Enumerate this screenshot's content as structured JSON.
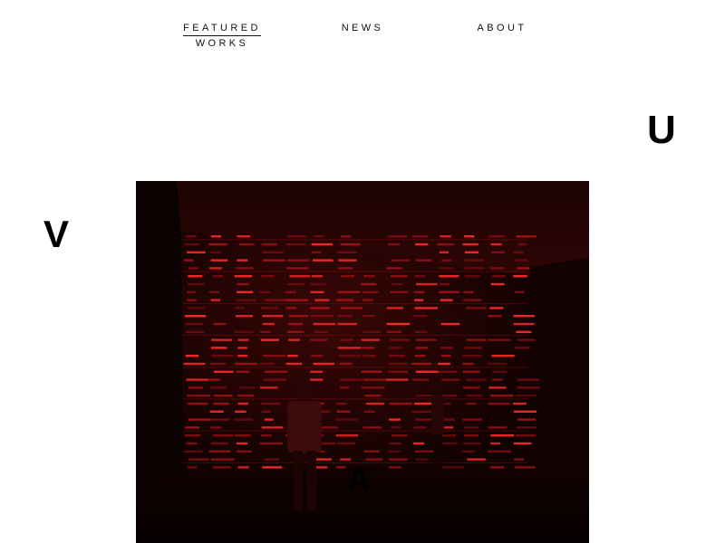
{
  "nav": {
    "featured_line1": "FEATURED",
    "featured_line2": "WORKS",
    "news": "NEWS",
    "about": "ABOUT"
  },
  "decor": {
    "letter_u": "U",
    "letter_v": "V",
    "letter_a": "A"
  },
  "hero": {
    "image_subject": "red LED numeric counter installation with two visitors",
    "palette": {
      "dark": "#0d0202",
      "red": "#c4141a",
      "glow": "#ff2a2a"
    }
  }
}
